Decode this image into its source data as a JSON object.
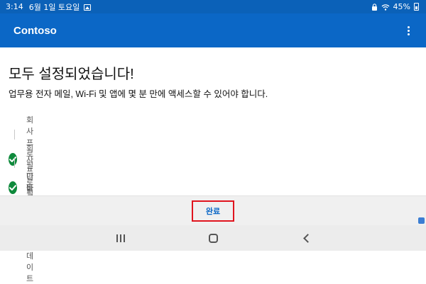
{
  "status_bar": {
    "time": "3:14",
    "date": "6월 1일 토요일",
    "battery": "45%",
    "icons": [
      "gallery-icon",
      "lock-icon",
      "wifi-icon",
      "battery-icon"
    ]
  },
  "app_bar": {
    "title": "Contoso",
    "menu_icon": "more-vertical-icon"
  },
  "main": {
    "heading": "모두 설정되었습니다!",
    "subtitle": "업무용 전자 메일, Wi-Fi 및 앱에 몇 분 만에 액세스할 수 있어야 합니다.",
    "steps": [
      {
        "label": "회사 프로필 만들기",
        "status": "complete"
      },
      {
        "label": "회사 프로필 활성화",
        "status": "complete"
      },
      {
        "label": "디바이스 설정 업데이트",
        "status": "complete"
      }
    ]
  },
  "footer": {
    "done_label": "완료"
  },
  "nav_bar": {
    "buttons": [
      "recents-icon",
      "home-icon",
      "back-icon"
    ]
  },
  "colors": {
    "app_bar": "#0b67c6",
    "status_bar": "#0b61b8",
    "check": "#0f8a3c",
    "done_text": "#0b67c6",
    "highlight": "#e0141e"
  }
}
